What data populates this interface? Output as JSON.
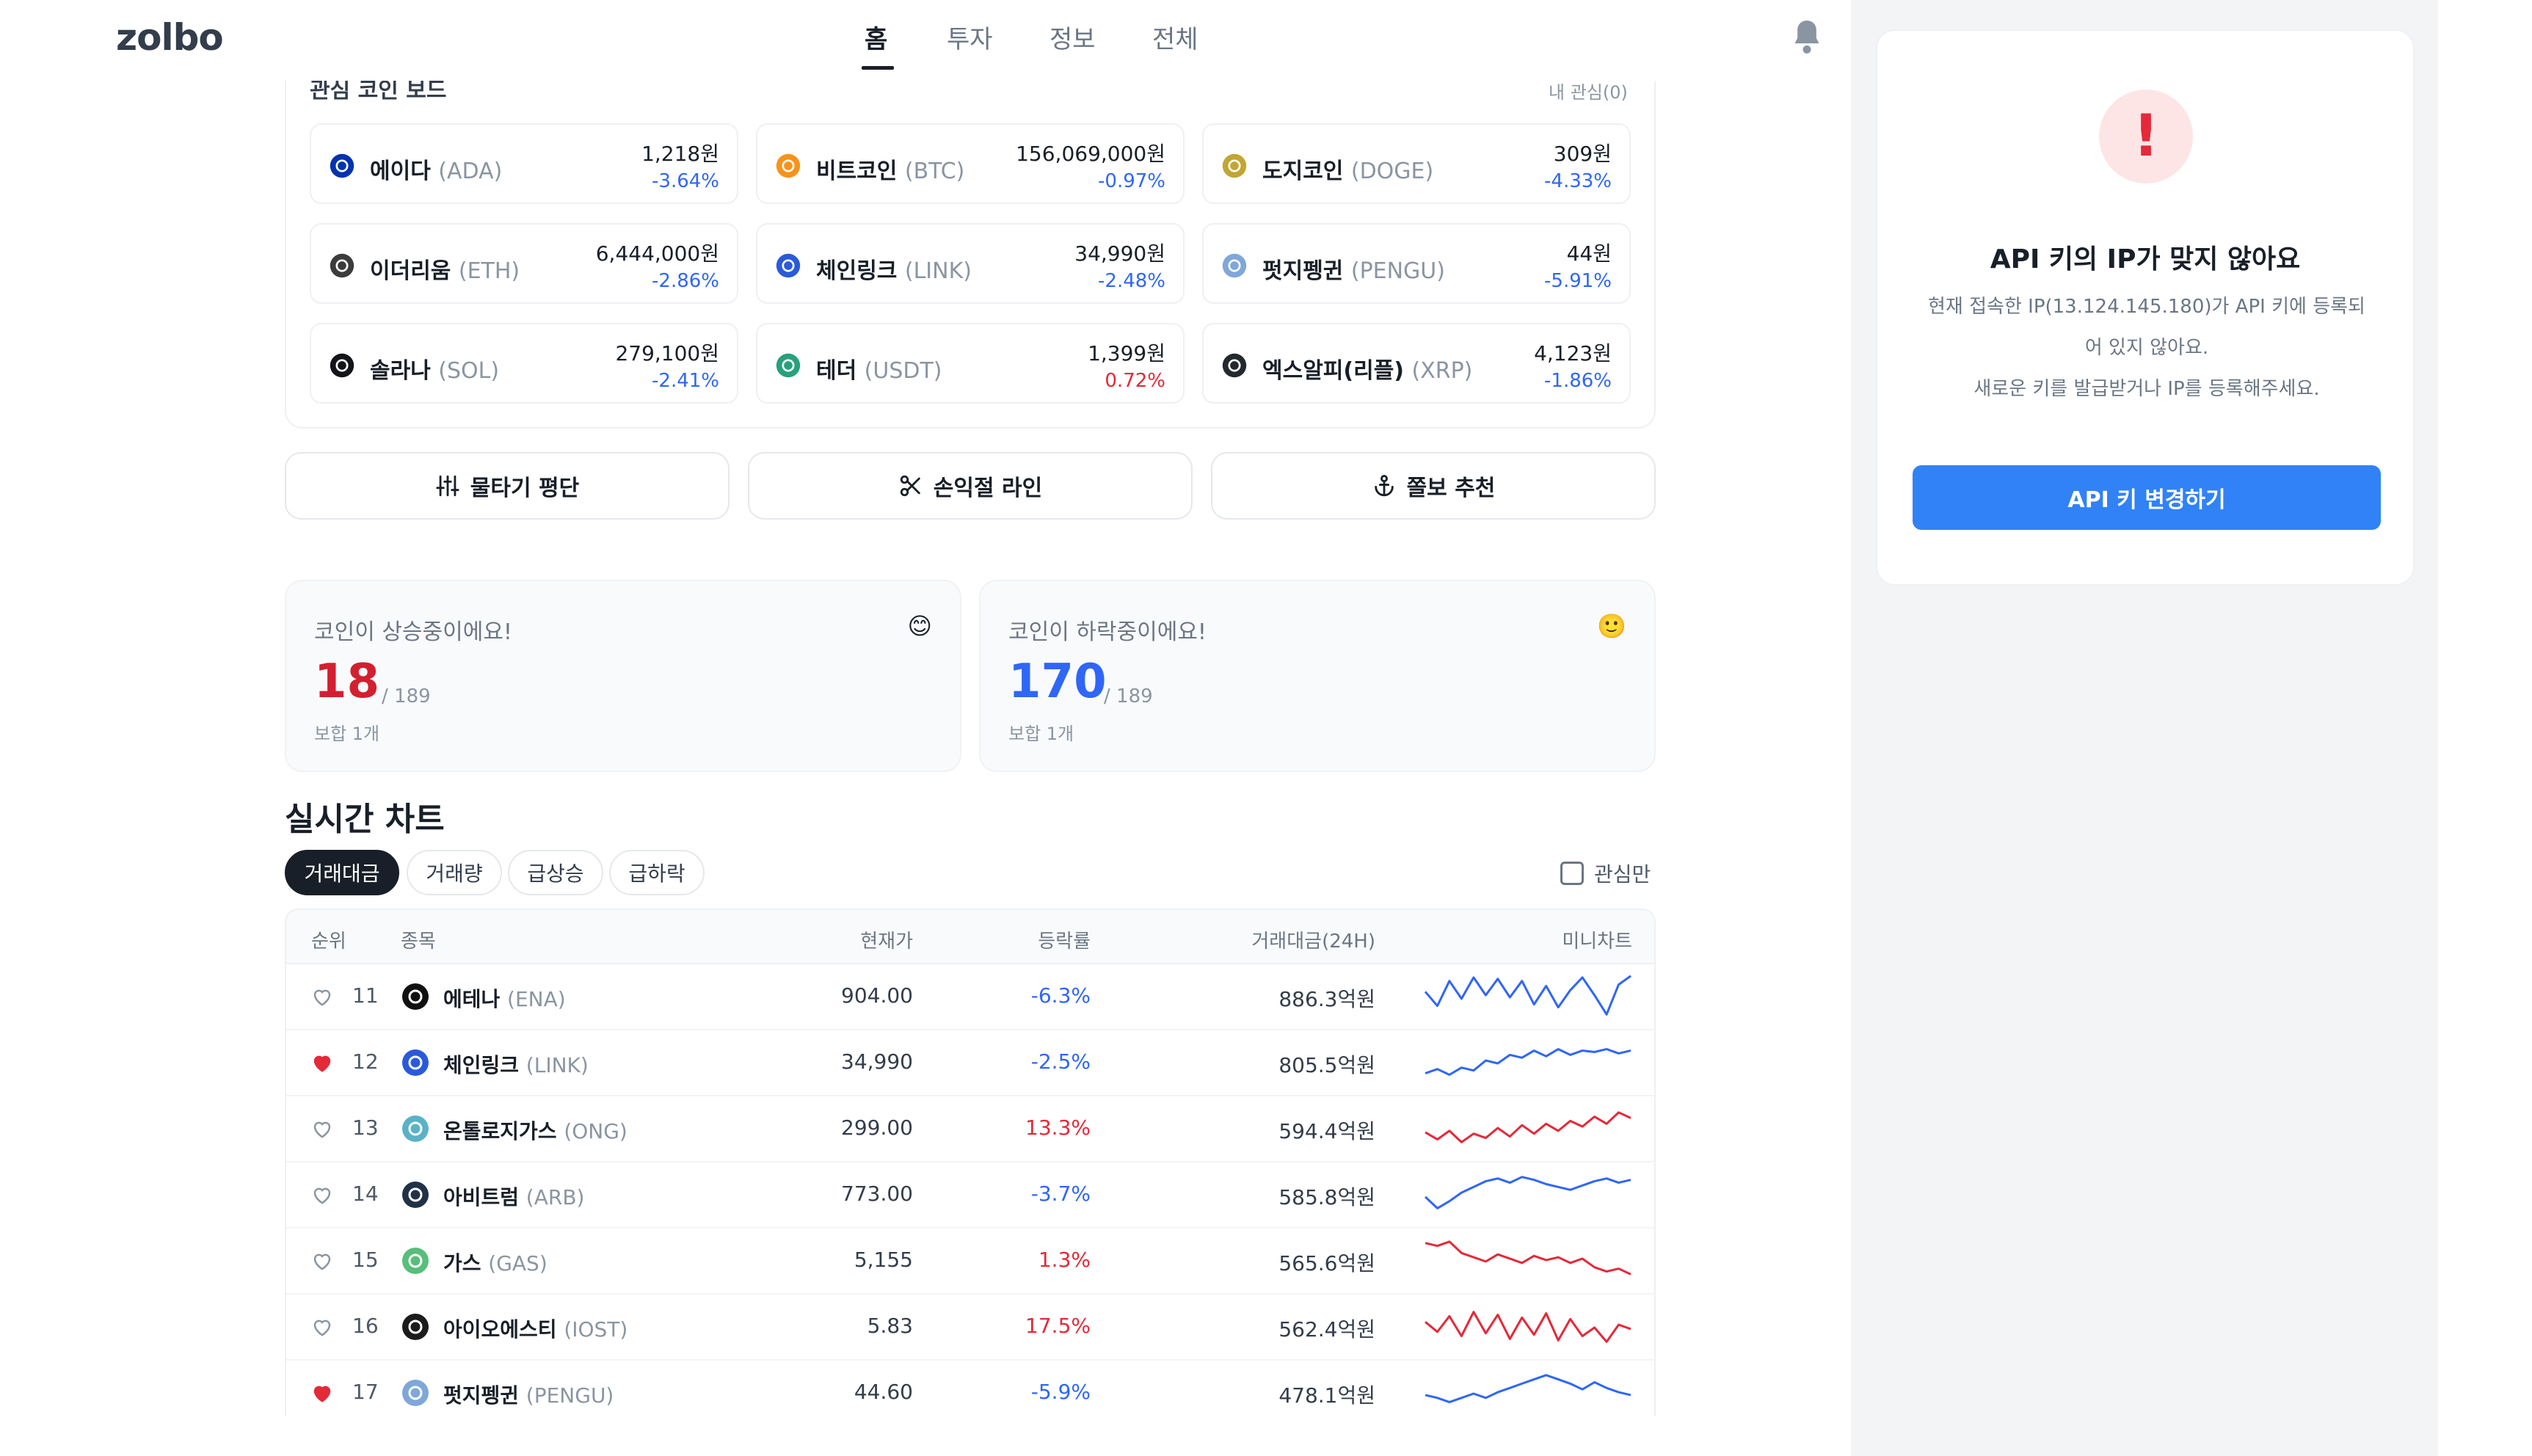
{
  "app": {
    "logo": "zolbo"
  },
  "nav": {
    "tabs": [
      "홈",
      "투자",
      "정보",
      "전체"
    ],
    "active": 0
  },
  "watch_board": {
    "title": "관심 코인 보드",
    "count_label": "내 관심(0)",
    "coins": [
      {
        "name": "에이다",
        "symbol": "(ADA)",
        "price": "1,218원",
        "change": "-3.64%",
        "dir": "down",
        "icon": "cardano-icon",
        "color": "#0033ad"
      },
      {
        "name": "비트코인",
        "symbol": "(BTC)",
        "price": "156,069,000원",
        "change": "-0.97%",
        "dir": "down",
        "icon": "bitcoin-icon",
        "color": "#f7931a"
      },
      {
        "name": "도지코인",
        "symbol": "(DOGE)",
        "price": "309원",
        "change": "-4.33%",
        "dir": "down",
        "icon": "dogecoin-icon",
        "color": "#c2a633"
      },
      {
        "name": "이더리움",
        "symbol": "(ETH)",
        "price": "6,444,000원",
        "change": "-2.86%",
        "dir": "down",
        "icon": "ethereum-icon",
        "color": "#3c3c3d"
      },
      {
        "name": "체인링크",
        "symbol": "(LINK)",
        "price": "34,990원",
        "change": "-2.48%",
        "dir": "down",
        "icon": "chainlink-icon",
        "color": "#2a5ada"
      },
      {
        "name": "펏지펭귄",
        "symbol": "(PENGU)",
        "price": "44원",
        "change": "-5.91%",
        "dir": "down",
        "icon": "pengu-icon",
        "color": "#7fa7d9"
      },
      {
        "name": "솔라나",
        "symbol": "(SOL)",
        "price": "279,100원",
        "change": "-2.41%",
        "dir": "down",
        "icon": "solana-icon",
        "color": "#14151a"
      },
      {
        "name": "테더",
        "symbol": "(USDT)",
        "price": "1,399원",
        "change": "0.72%",
        "dir": "up",
        "icon": "tether-icon",
        "color": "#26a17b"
      },
      {
        "name": "엑스알피(리플)",
        "symbol": "(XRP)",
        "price": "4,123원",
        "change": "-1.86%",
        "dir": "down",
        "icon": "xrp-icon",
        "color": "#23292f"
      }
    ]
  },
  "tools": [
    {
      "label": "물타기 평단",
      "icon": "sliders-icon"
    },
    {
      "label": "손익절 라인",
      "icon": "scissors-icon"
    },
    {
      "label": "쫄보 추천",
      "icon": "anchor-icon"
    }
  ],
  "stats": {
    "rising": {
      "title": "코인이 상승중이에요!",
      "emoji": "😊",
      "count": "18",
      "total": "/ 189",
      "sub": "보합 1개",
      "color": "#d22030"
    },
    "falling": {
      "title": "코인이 하락중이에요!",
      "emoji": "🙂",
      "count": "170",
      "total": "/ 189",
      "sub": "보합 1개",
      "color": "#2f66f6"
    }
  },
  "realtime": {
    "title": "실시간 차트",
    "filters": [
      "거래대금",
      "거래량",
      "급상승",
      "급하락"
    ],
    "active_filter": 0,
    "watch_only_label": "관심만",
    "columns": [
      "순위",
      "종목",
      "현재가",
      "등락률",
      "거래대금(24H)",
      "미니차트"
    ],
    "rows": [
      {
        "rank": "11",
        "name": "에테나",
        "symbol": "(ENA)",
        "price": "904.00",
        "change": "-6.3%",
        "dir": "down",
        "volume": "886.3억원",
        "liked": false,
        "icon": "ethena-icon",
        "color": "#111111",
        "spark": [
          40,
          20,
          55,
          30,
          60,
          35,
          58,
          32,
          55,
          22,
          48,
          18,
          42,
          60,
          35,
          8,
          50,
          62
        ]
      },
      {
        "rank": "12",
        "name": "체인링크",
        "symbol": "(LINK)",
        "price": "34,990",
        "change": "-2.5%",
        "dir": "down",
        "volume": "805.5억원",
        "liked": true,
        "icon": "chainlink-icon",
        "color": "#2a5ada",
        "spark": [
          18,
          24,
          16,
          26,
          22,
          36,
          32,
          44,
          40,
          50,
          42,
          52,
          44,
          50,
          48,
          52,
          46,
          50
        ]
      },
      {
        "rank": "13",
        "name": "온톨로지가스",
        "symbol": "(ONG)",
        "price": "299.00",
        "change": "13.3%",
        "dir": "up",
        "volume": "594.4억원",
        "liked": false,
        "icon": "ontology-gas-icon",
        "color": "#5ab2c8",
        "spark": [
          28,
          18,
          30,
          14,
          26,
          20,
          34,
          22,
          38,
          26,
          40,
          30,
          44,
          36,
          50,
          40,
          56,
          48
        ]
      },
      {
        "rank": "14",
        "name": "아비트럼",
        "symbol": "(ARB)",
        "price": "773.00",
        "change": "-3.7%",
        "dir": "down",
        "volume": "585.8억원",
        "liked": false,
        "icon": "arbitrum-icon",
        "color": "#213147",
        "spark": [
          30,
          14,
          24,
          36,
          44,
          52,
          56,
          50,
          58,
          54,
          48,
          44,
          40,
          46,
          52,
          56,
          50,
          54
        ]
      },
      {
        "rank": "15",
        "name": "가스",
        "symbol": "(GAS)",
        "price": "5,155",
        "change": "1.3%",
        "dir": "up",
        "volume": "565.6억원",
        "liked": false,
        "icon": "gas-icon",
        "color": "#58be7a",
        "spark": [
          58,
          54,
          60,
          44,
          38,
          32,
          42,
          36,
          30,
          40,
          34,
          38,
          30,
          36,
          24,
          18,
          22,
          14
        ]
      },
      {
        "rank": "16",
        "name": "아이오에스티",
        "symbol": "(IOST)",
        "price": "5.83",
        "change": "17.5%",
        "dir": "up",
        "volume": "562.4억원",
        "liked": false,
        "icon": "iost-icon",
        "color": "#1c1c1c",
        "spark": [
          40,
          26,
          48,
          20,
          54,
          24,
          50,
          16,
          46,
          22,
          52,
          14,
          44,
          20,
          32,
          12,
          36,
          30
        ]
      },
      {
        "rank": "17",
        "name": "펏지펭귄",
        "symbol": "(PENGU)",
        "price": "44.60",
        "change": "-5.9%",
        "dir": "down",
        "volume": "478.1억원",
        "liked": true,
        "icon": "pengu-icon",
        "color": "#7fa7d9",
        "spark": [
          30,
          26,
          20,
          26,
          32,
          26,
          34,
          40,
          46,
          52,
          58,
          52,
          46,
          38,
          48,
          40,
          34,
          30
        ]
      }
    ]
  },
  "api_error": {
    "icon": "!",
    "title": "API 키의 IP가 맞지 않아요",
    "desc_line1": "현재 접속한 IP(13.124.145.180)가 API 키에 등록되",
    "desc_line2": "어 있지 않아요.",
    "desc_line3": "새로운 키를 발급받거나 IP를 등록해주세요.",
    "button": "API 키 변경하기"
  },
  "colors": {
    "up": "#e42939",
    "down": "#2f66f6",
    "accent": "#3182f6"
  }
}
